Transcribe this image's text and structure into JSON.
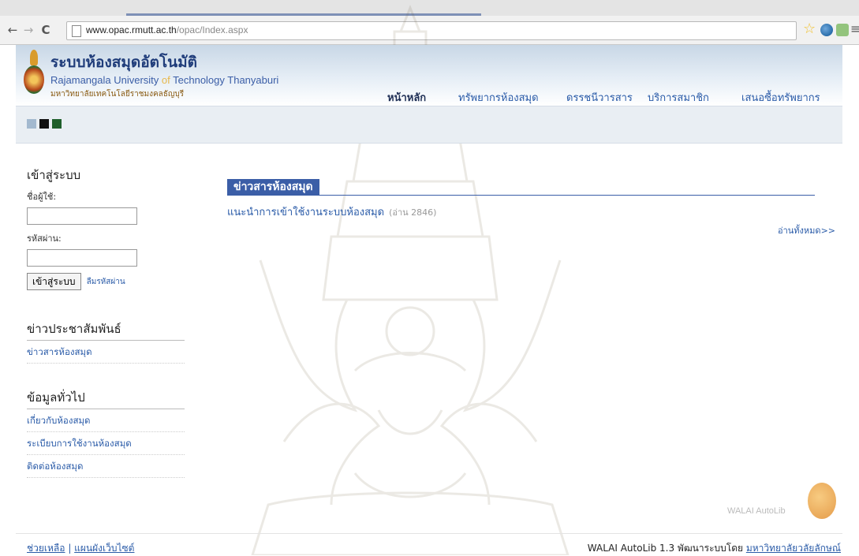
{
  "browser": {
    "url_host": "www.opac.rmutt.ac.th",
    "url_path": "/opac/Index.aspx",
    "back_icon": "←",
    "forward_icon": "→",
    "reload_icon": "C",
    "star_icon": "☆",
    "menu_icon": "≡"
  },
  "header": {
    "site_title": "ระบบห้องสมุดอัตโนมัติ",
    "univ_en_a": "Rajamangala University ",
    "univ_en_of": "of",
    "univ_en_b": " Technology Thanyaburi",
    "univ_th": "มหาวิทยาลัยเทคโนโลยีราชมงคลธัญบุรี",
    "nav": [
      {
        "label": "หน้าหลัก",
        "active": true
      },
      {
        "label": "ทรัพยากรห้องสมุด",
        "active": false
      },
      {
        "label": "ดรรชนีวารสาร",
        "active": false
      },
      {
        "label": "บริการสมาชิก",
        "active": false
      },
      {
        "label": "เสนอซื้อทรัพยากร",
        "active": false
      }
    ]
  },
  "colors": {
    "swatch_light": "#a3b9cf",
    "swatch_black": "#111111",
    "swatch_green": "#1f5f2b",
    "accent": "#3b5ea7",
    "link": "#2a5ba8"
  },
  "login": {
    "heading": "เข้าสู่ระบบ",
    "username_label": "ชื่อผู้ใช้:",
    "username_value": "",
    "password_label": "รหัสผ่าน:",
    "password_value": "",
    "submit_label": "เข้าสู่ระบบ",
    "forgot_label": "ลืมรหัสผ่าน"
  },
  "pr": {
    "heading": "ข่าวประชาสัมพันธ์",
    "links": [
      "ข่าวสารห้องสมุด"
    ]
  },
  "general": {
    "heading": "ข้อมูลทั่วไป",
    "links": [
      "เกี่ยวกับห้องสมุด",
      "ระเบียบการใช้งานห้องสมุด",
      "ติดต่อห้องสมุด"
    ]
  },
  "news": {
    "section_title": "ข่าวสารห้องสมุด",
    "items": [
      {
        "title": "แนะนำการเข้าใช้งานระบบห้องสมุด",
        "reads": "(อ่าน 2846)"
      }
    ],
    "read_all": "อ่านทั้งหมด>>"
  },
  "brand": {
    "text": "WALAI AutoLib"
  },
  "footer": {
    "help": "ช่วยเหลือ",
    "separator": " | ",
    "sitemap": "แผนผังเว็บไซต์",
    "credit_prefix": "WALAI AutoLib 1.3 พัฒนาระบบโดย ",
    "credit_link": "มหาวิทยาลัยวลัยลักษณ์"
  }
}
